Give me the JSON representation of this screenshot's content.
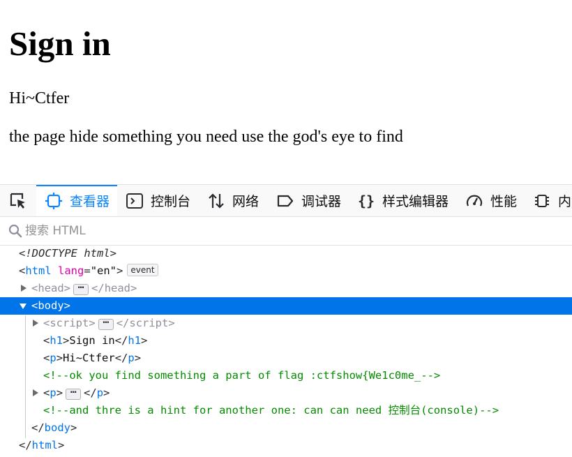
{
  "page": {
    "heading": "Sign in",
    "greeting": "Hi~Ctfer",
    "hint": "the page hide something you need use the god's eye to find"
  },
  "devtools": {
    "tabs": [
      {
        "label": "查看器",
        "icon": "inspector-icon",
        "active": true
      },
      {
        "label": "控制台",
        "icon": "console-icon"
      },
      {
        "label": "网络",
        "icon": "network-icon"
      },
      {
        "label": "调试器",
        "icon": "debugger-icon"
      },
      {
        "label": "样式编辑器",
        "icon": "style-editor-icon"
      },
      {
        "label": "性能",
        "icon": "performance-icon"
      },
      {
        "label": "内",
        "icon": "memory-icon"
      }
    ],
    "search": {
      "placeholder": "搜索 HTML"
    },
    "tree": {
      "doctype": "<!DOCTYPE html>",
      "html_tag": "html",
      "lang_attr": "lang",
      "lang_value": "\"en\"",
      "event_badge": "event",
      "head_tag": "head",
      "body_tag": "body",
      "script_tag": "script",
      "h1_tag": "h1",
      "h1_text": "Sign in",
      "p_tag": "p",
      "p_text": "Hi~Ctfer",
      "comment1": "<!--ok you find something a part of flag :ctfshow{We1c0me_-->",
      "comment2": "<!--and thre is a hint for another one: can can need 控制台(console)-->",
      "ellipsis": "⋯"
    }
  },
  "colors": {
    "accent": "#0a84ff",
    "selected_row": "#0074e8",
    "tag": "#0074e8",
    "attr": "#dd00a9",
    "comment": "#058b00"
  }
}
